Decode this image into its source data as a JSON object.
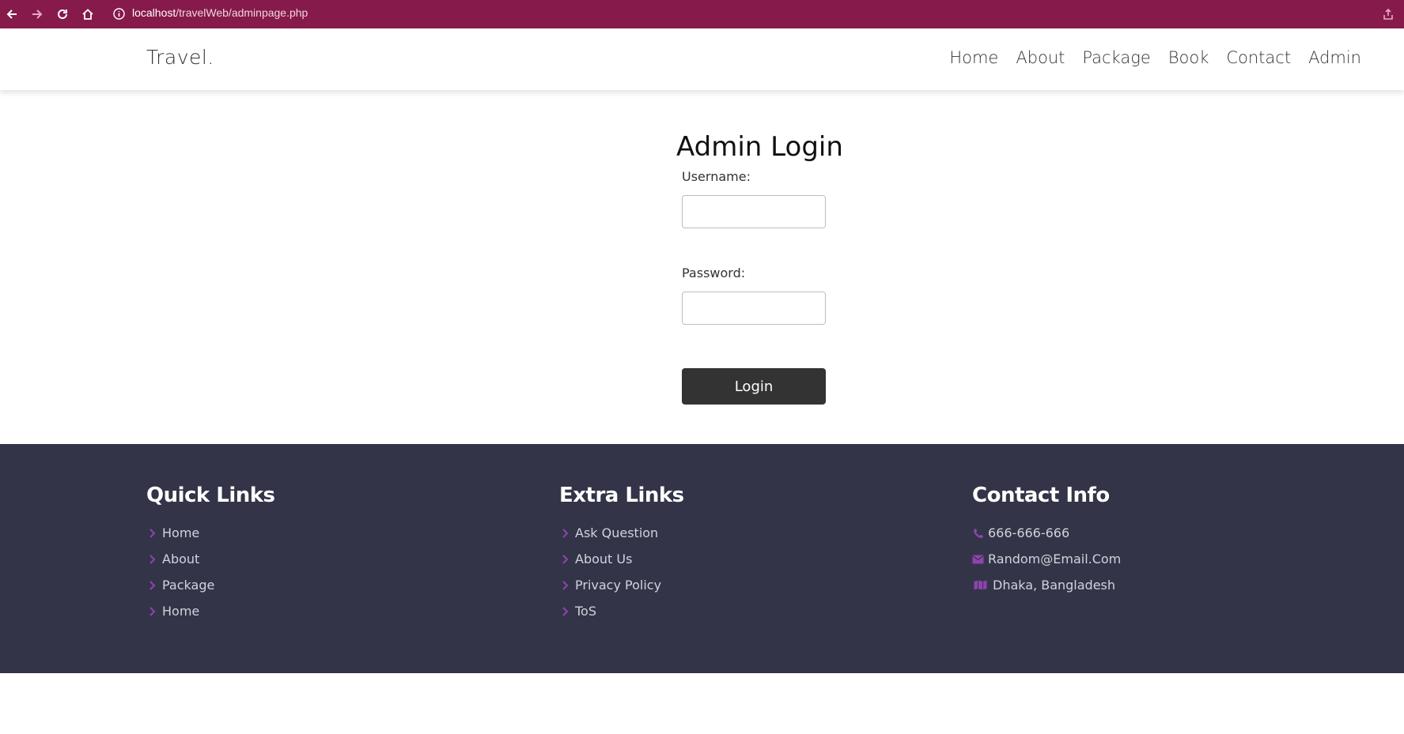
{
  "browser": {
    "url_host": "localhost",
    "url_path": "/travelWeb/adminpage.php"
  },
  "site": {
    "logo": "Travel.",
    "nav": [
      "Home",
      "About",
      "Package",
      "Book",
      "Contact",
      "Admin"
    ]
  },
  "login": {
    "title": "Admin Login",
    "username_label": "Username:",
    "username_value": "",
    "password_label": "Password:",
    "password_value": "",
    "button_label": "Login"
  },
  "footer": {
    "quick_links": {
      "title": "Quick Links",
      "items": [
        "Home",
        "About",
        "Package",
        "Home"
      ]
    },
    "extra_links": {
      "title": "Extra Links",
      "items": [
        "Ask Question",
        "About Us",
        "Privacy Policy",
        "ToS"
      ]
    },
    "contact_info": {
      "title": "Contact Info",
      "phone": "666-666-666",
      "email": "Random@Email.Com",
      "address": "Dhaka, Bangladesh"
    }
  },
  "colors": {
    "browser_bar": "#861a4b",
    "footer_bg": "#333448",
    "accent_purple": "#8e44ad",
    "button_bg": "#333333"
  },
  "icons": {
    "back": "arrow-left-icon",
    "forward": "arrow-right-icon",
    "reload": "reload-icon",
    "home": "home-icon",
    "info": "info-icon",
    "share": "share-icon",
    "chevron": "chevron-right-icon",
    "phone": "phone-icon",
    "email": "envelope-icon",
    "map": "map-icon"
  }
}
